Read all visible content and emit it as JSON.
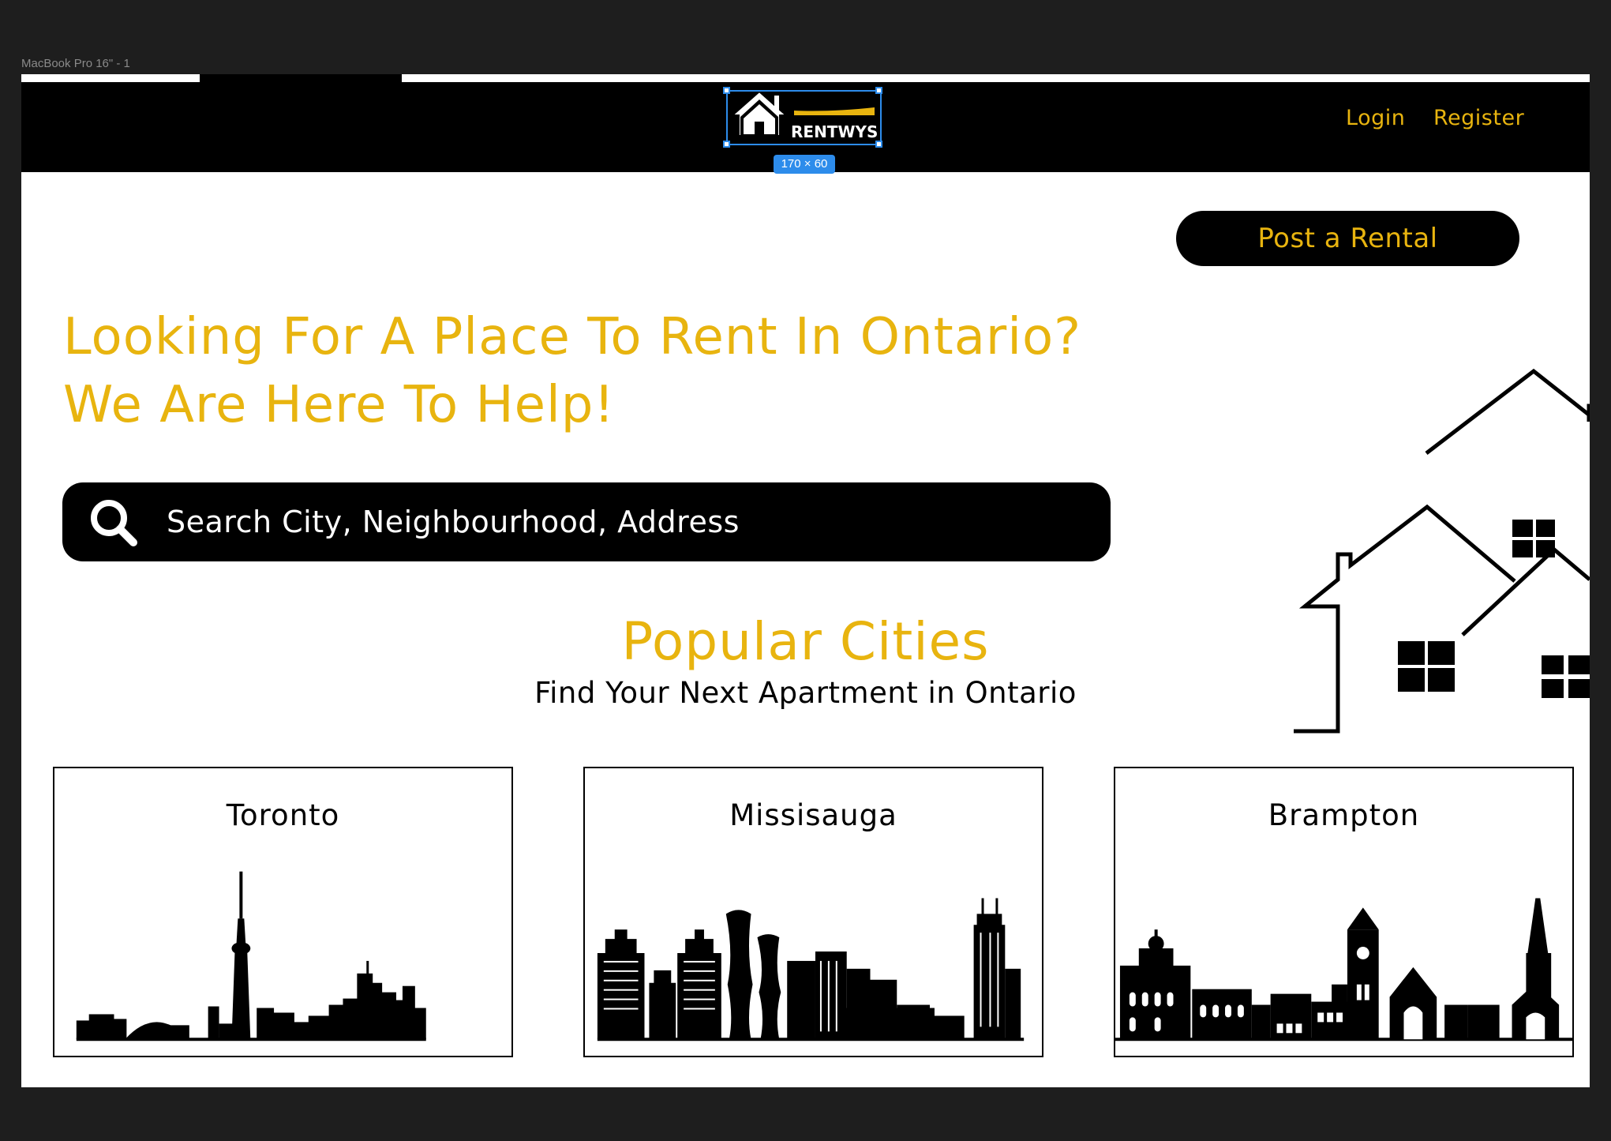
{
  "frame": {
    "label": "MacBook Pro 16\" - 1"
  },
  "header": {
    "logo_text": "RENTWYSE",
    "selection_size": "170 × 60",
    "nav": {
      "login": "Login",
      "register": "Register"
    }
  },
  "post_rental": {
    "label": "Post a Rental"
  },
  "hero": {
    "line1": "Looking For A Place To Rent In Ontario?",
    "line2": "We Are Here To Help!"
  },
  "search": {
    "placeholder": "Search City, Neighbourhood, Address",
    "icon": "search-icon"
  },
  "popular": {
    "title": "Popular Cities",
    "subtitle": "Find Your Next Apartment in Ontario",
    "cities": [
      {
        "name": "Toronto"
      },
      {
        "name": "Missisauga"
      },
      {
        "name": "Brampton"
      }
    ]
  },
  "colors": {
    "accent": "#e8b40f",
    "dark": "#000000",
    "selection": "#2d8ceb"
  }
}
